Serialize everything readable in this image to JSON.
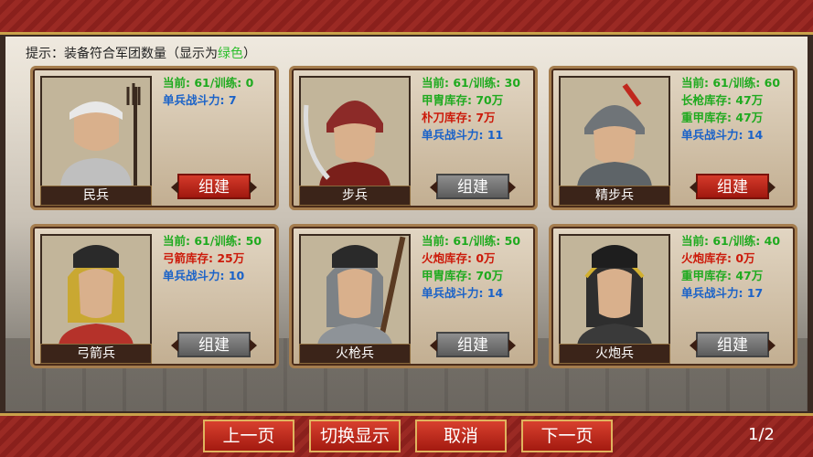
{
  "hint": {
    "prefix": "提示：装备符合军团数量（显示为",
    "green_word": "绿色",
    "suffix": "）"
  },
  "units": [
    {
      "name": "民兵",
      "icon": "militia-portrait",
      "lines": [
        {
          "text": "当前: 61/训练: 0",
          "color": "green"
        },
        {
          "text": "单兵战斗力: 7",
          "color": "blue"
        }
      ],
      "button": {
        "label": "组建",
        "style": "red"
      }
    },
    {
      "name": "步兵",
      "icon": "infantry-portrait",
      "lines": [
        {
          "text": "当前: 61/训练: 30",
          "color": "green"
        },
        {
          "text": "甲胄库存: 70万",
          "color": "green"
        },
        {
          "text": "朴刀库存: 7万",
          "color": "red"
        },
        {
          "text": "单兵战斗力: 11",
          "color": "blue"
        }
      ],
      "button": {
        "label": "组建",
        "style": "gray"
      }
    },
    {
      "name": "精步兵",
      "icon": "elite-infantry-portrait",
      "lines": [
        {
          "text": "当前: 61/训练: 60",
          "color": "green"
        },
        {
          "text": "长枪库存: 47万",
          "color": "green"
        },
        {
          "text": "重甲库存: 47万",
          "color": "green"
        },
        {
          "text": "单兵战斗力: 14",
          "color": "blue"
        }
      ],
      "button": {
        "label": "组建",
        "style": "red"
      }
    },
    {
      "name": "弓箭兵",
      "icon": "archer-portrait",
      "lines": [
        {
          "text": "当前: 61/训练: 50",
          "color": "green"
        },
        {
          "text": "弓箭库存: 25万",
          "color": "red"
        },
        {
          "text": "单兵战斗力: 10",
          "color": "blue"
        }
      ],
      "button": {
        "label": "组建",
        "style": "gray"
      }
    },
    {
      "name": "火枪兵",
      "icon": "musketeer-portrait",
      "lines": [
        {
          "text": "当前: 61/训练: 50",
          "color": "green"
        },
        {
          "text": "火炮库存: 0万",
          "color": "red"
        },
        {
          "text": "甲胄库存: 70万",
          "color": "green"
        },
        {
          "text": "单兵战斗力: 14",
          "color": "blue"
        }
      ],
      "button": {
        "label": "组建",
        "style": "gray"
      }
    },
    {
      "name": "火炮兵",
      "icon": "artillery-portrait",
      "lines": [
        {
          "text": "当前: 61/训练: 40",
          "color": "green"
        },
        {
          "text": "火炮库存: 0万",
          "color": "red"
        },
        {
          "text": "重甲库存: 47万",
          "color": "green"
        },
        {
          "text": "单兵战斗力: 17",
          "color": "blue"
        }
      ],
      "button": {
        "label": "组建",
        "style": "gray"
      }
    }
  ],
  "nav": {
    "prev": "上一页",
    "toggle": "切换显示",
    "cancel": "取消",
    "next": "下一页"
  },
  "page": "1/2",
  "colors": {
    "green": "#1faa1f",
    "red": "#cc1a0a",
    "blue": "#1a62c8",
    "accent": "#9b2a24"
  }
}
